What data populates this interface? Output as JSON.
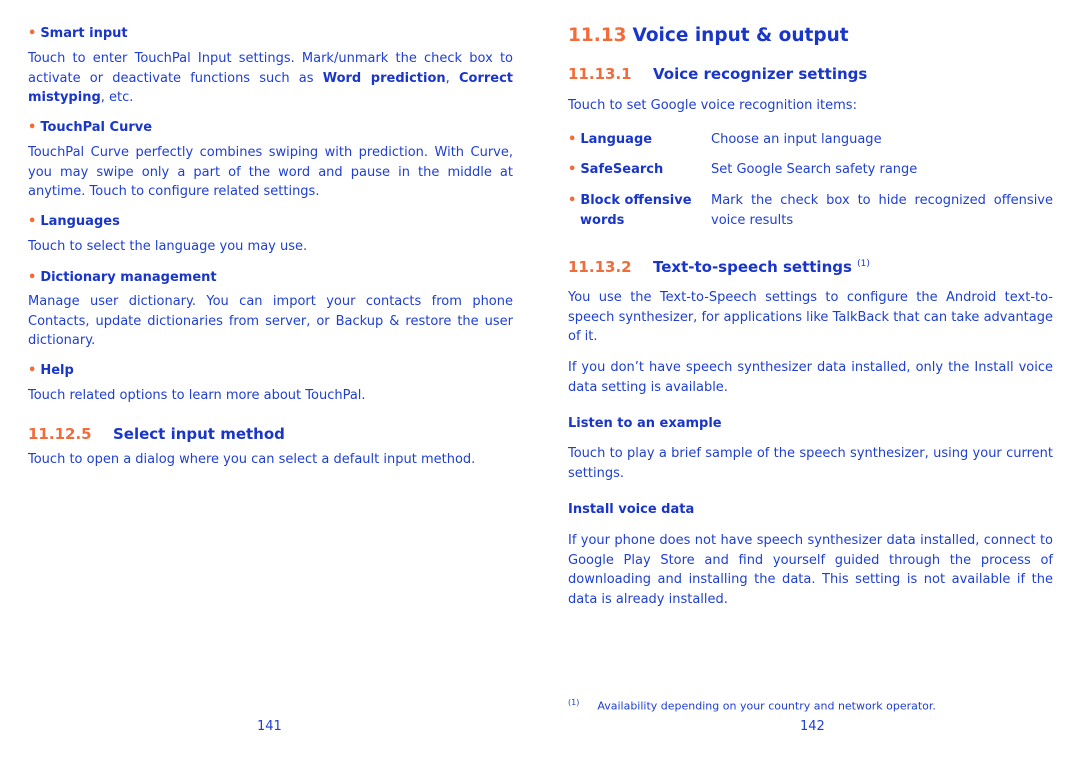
{
  "left_page": {
    "sections": [
      {
        "title": "Smart input",
        "body_parts": [
          "Touch to enter TouchPal Input settings. Mark/unmark the check box to activate or deactivate functions such as ",
          "Word prediction",
          ", ",
          "Correct mistyping",
          ", etc."
        ]
      },
      {
        "title": "TouchPal Curve",
        "body": "TouchPal Curve perfectly combines swiping with prediction. With Curve, you may swipe only a part of the word and pause in the middle at anytime. Touch to configure related settings."
      },
      {
        "title": "Languages",
        "body": "Touch to select the language you may use."
      },
      {
        "title": "Dictionary management",
        "body": "Manage user dictionary. You can import your contacts from phone Contacts, update dictionaries from server, or Backup & restore  the user dictionary."
      },
      {
        "title": "Help",
        "body": "Touch related options to learn more about TouchPal."
      }
    ],
    "subsection": {
      "number": "11.12.5",
      "title": "Select input method",
      "body": "Touch to open a dialog where you can select a default input method."
    },
    "page_number": "141"
  },
  "right_page": {
    "section": {
      "number": "11.13",
      "title": "Voice input & output"
    },
    "sub1": {
      "number": "11.13.1",
      "title": "Voice recognizer settings",
      "intro": "Touch to set Google voice recognition items:",
      "items": [
        {
          "key": "Language",
          "value": "Choose an input language"
        },
        {
          "key": "SafeSearch",
          "value": "Set Google Search safety range"
        },
        {
          "key": "Block offensive words",
          "value": "Mark the check box to hide recognized offensive voice results"
        }
      ]
    },
    "sub2": {
      "number": "11.13.2",
      "title": "Text-to-speech settings",
      "footnote_ref": "(1)",
      "para1": "You use the Text-to-Speech settings to configure the Android text-to-speech synthesizer, for applications like TalkBack that can take advantage of it.",
      "para2": "If you don’t have speech synthesizer data installed, only the Install voice data setting is available.",
      "listen_title": "Listen to an example",
      "listen_body": "Touch to play a brief sample of the speech synthesizer, using your current settings.",
      "install_title": "Install voice data",
      "install_body": "If your phone does not have speech synthesizer data installed, connect to Google Play Store and find yourself guided through the process of downloading and installing the data. This setting is not available if the data is already installed."
    },
    "footnote": {
      "marker": "(1)",
      "text": "Availability depending on your country and network operator."
    },
    "page_number": "142"
  },
  "colors": {
    "accent_orange": "#f26b3a",
    "text_blue": "#1f3fd0",
    "heading_blue": "#1a36c8"
  }
}
